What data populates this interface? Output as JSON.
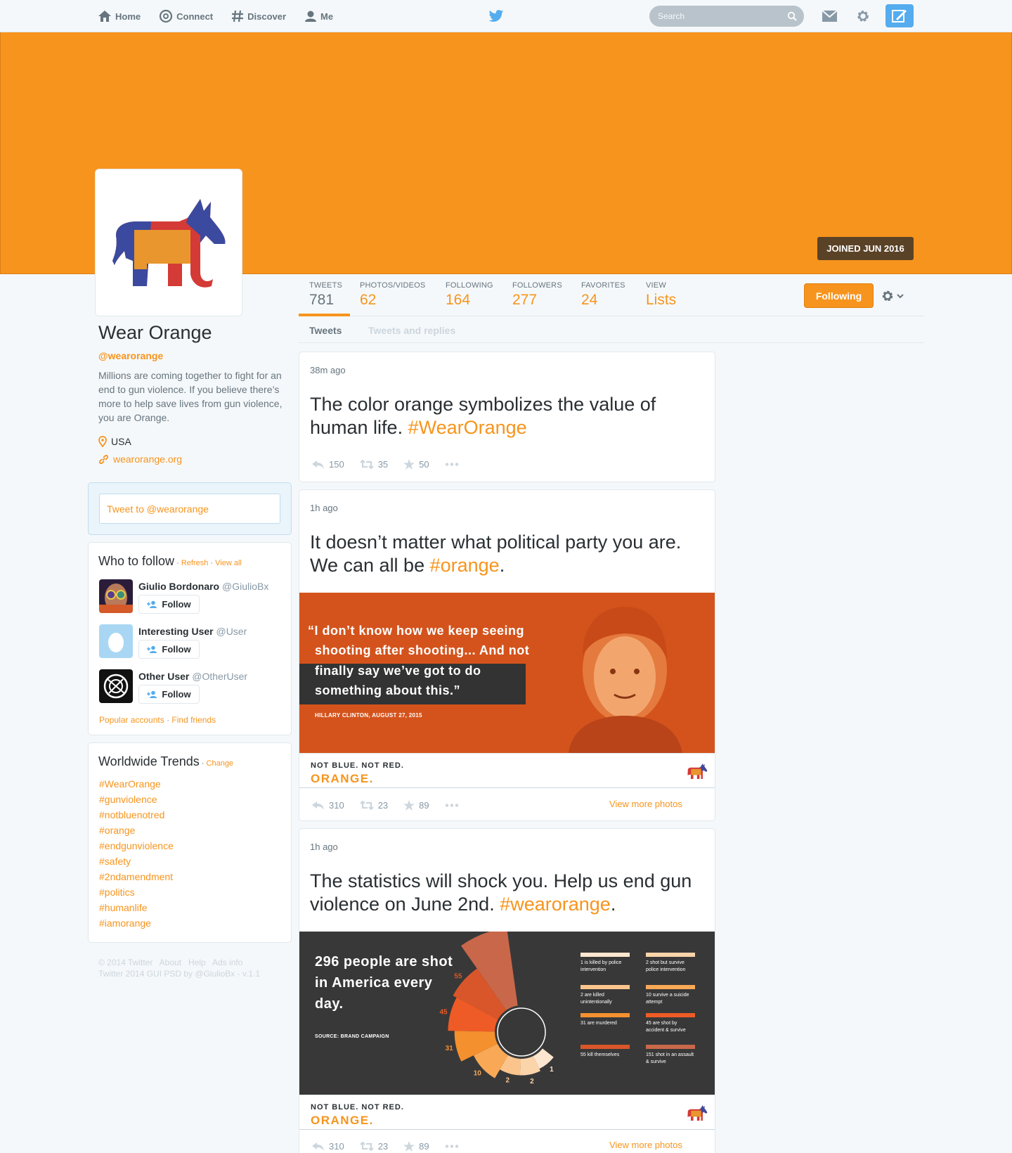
{
  "nav": {
    "home": "Home",
    "connect": "Connect",
    "discover": "Discover",
    "me": "Me",
    "search_placeholder": "Search"
  },
  "colors": {
    "accent": "#f7941d",
    "link_blue": "#55acee",
    "joined_badge": "#5a4227"
  },
  "icons": [
    "home-icon",
    "at-icon",
    "hashtag-icon",
    "person-icon",
    "twitter-bird-icon",
    "search-icon",
    "envelope-icon",
    "gear-icon",
    "compose-icon",
    "location-pin-icon",
    "link-icon",
    "add-user-icon",
    "reply-icon",
    "retweet-icon",
    "star-icon",
    "more-icon",
    "donkey-logo-icon"
  ],
  "cover": {
    "joined": "JOINED JUN 2016"
  },
  "profile": {
    "name": "Wear Orange",
    "handle": "@wearorange",
    "bio": "Millions are coming together to fight for an end to gun violence. If you believe there’s more to help save lives from gun violence, you are Orange.",
    "location": "USA",
    "website": "wearorange.org"
  },
  "stats": [
    {
      "label": "TWEETS",
      "value": "781"
    },
    {
      "label": "PHOTOS/VIDEOS",
      "value": "62"
    },
    {
      "label": "FOLLOWING",
      "value": "164"
    },
    {
      "label": "FOLLOWERS",
      "value": "277"
    },
    {
      "label": "FAVORITES",
      "value": "24"
    },
    {
      "label": "VIEW",
      "value": "Lists"
    }
  ],
  "following_label": "Following",
  "tabs": {
    "tweets": "Tweets",
    "replies": "Tweets and replies"
  },
  "tweet_to_placeholder": "Tweet to @wearorange",
  "who_to_follow": {
    "title": "Who to follow",
    "dot": " · ",
    "refresh": "Refresh",
    "view_all": "View all",
    "follow_label": "Follow",
    "users": [
      {
        "name": "Giulio Bordonaro",
        "handle": "@GiulioBx"
      },
      {
        "name": "Interesting User",
        "handle": "@User"
      },
      {
        "name": "Other User",
        "handle": "@OtherUser"
      }
    ],
    "popular": "Popular accounts",
    "find_friends": "Find friends"
  },
  "trends": {
    "title": "Worldwide Trends",
    "change": "Change",
    "items": [
      "#WearOrange",
      "#gunviolence",
      "#notbluenotred",
      "#orange",
      "#endgunviolence",
      "#safety",
      "#2ndamendment",
      "#politics",
      "#humanlife",
      "#iamorange"
    ]
  },
  "footer": {
    "line1": "© 2014 Twitter   About   Help   Ads info",
    "line2": "Twitter 2014 GUI PSD by @GiulioBx - v.1.1"
  },
  "tweets": [
    {
      "time": "38m ago",
      "text": "The color orange symbolizes the value of human life. ",
      "hashtag": "#WearOrange",
      "after": "",
      "replies": "150",
      "retweets": "35",
      "favorites": "50"
    },
    {
      "time": "1h ago",
      "text": "It doesn’t matter what political party you are. We can all be ",
      "hashtag": "#orange",
      "after": ".",
      "replies": "310",
      "retweets": "23",
      "favorites": "89",
      "more_photos": "View more photos"
    },
    {
      "time": "1h ago",
      "text": "The statistics will shock you. Help us end gun violence on June 2nd. ",
      "hashtag": "#wearorange",
      "after": ".",
      "replies": "310",
      "retweets": "23",
      "favorites": "89",
      "more_photos": "View more photos"
    }
  ],
  "quote_card": {
    "lines": [
      "“I don’t know how we keep seeing",
      "shooting after shooting... And not",
      "finally say we’ve got to do",
      "something about this.”"
    ],
    "source": "HILLARY CLINTON, AUGUST 27, 2015"
  },
  "brand": {
    "line1": "NOT BLUE. NOT RED.",
    "line2": "ORANGE."
  },
  "infographic": {
    "headline": "296 people are shot in America every day.",
    "source": "SOURCE: BRAND CAMPAIGN",
    "segments": [
      {
        "value": "151",
        "color": "#c8674a"
      },
      {
        "value": "55",
        "color": "#d9562a"
      },
      {
        "value": "45",
        "color": "#ef5b26"
      },
      {
        "value": "31",
        "color": "#f5902e"
      },
      {
        "value": "10",
        "color": "#f9a956"
      },
      {
        "value": "2",
        "color": "#fbc48c"
      },
      {
        "value": "2",
        "color": "#fcd4aa"
      },
      {
        "value": "1",
        "color": "#fde6cf"
      }
    ],
    "legend": [
      {
        "text": "1 is killed by police intervention",
        "color": "#fde6cf"
      },
      {
        "text": "2 shot but survive police intervention",
        "color": "#fcd4aa"
      },
      {
        "text": "2 are killed unintentionally",
        "color": "#fbc48c"
      },
      {
        "text": "10 survive a suicide attempt",
        "color": "#f9a956"
      },
      {
        "text": "31 are murdered",
        "color": "#f5902e"
      },
      {
        "text": "45 are shot by accident & survive",
        "color": "#ef5b26"
      },
      {
        "text": "55 kill themselves",
        "color": "#d9562a"
      },
      {
        "text": "151 shot in an assault & survive",
        "color": "#c8674a"
      }
    ]
  }
}
